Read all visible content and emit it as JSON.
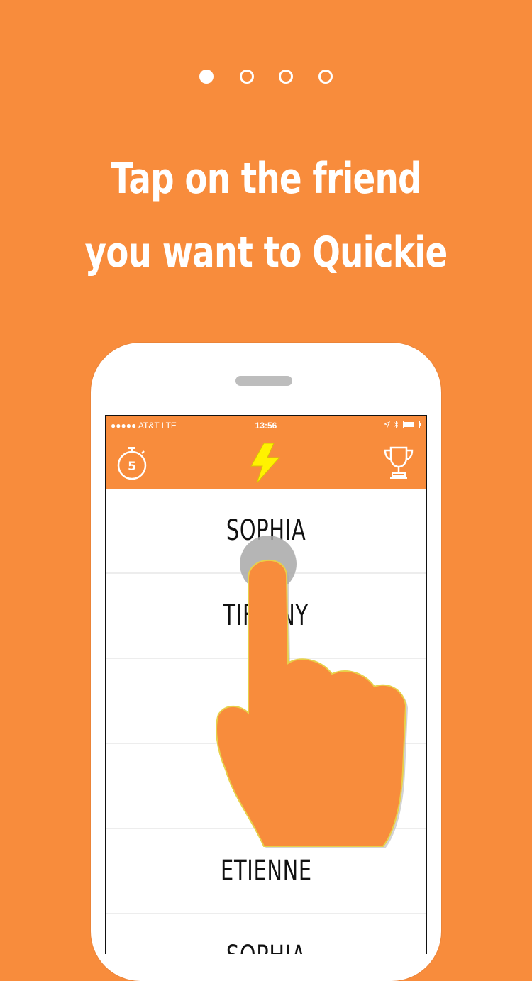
{
  "pager": {
    "count": 4,
    "active_index": 0
  },
  "headline": {
    "line1": "Tap on the friend",
    "line2": "you want to Quickie"
  },
  "status_bar": {
    "carrier": "●●●●● AT&T  LTE",
    "time": "13:56"
  },
  "nav": {
    "timer_value": "5",
    "icons": [
      "stopwatch-icon",
      "lightning-bolt-icon",
      "trophy-icon"
    ]
  },
  "friends": [
    "SOPHIA",
    "TIFFANY",
    "",
    "",
    "ETIENNE",
    "SOPHIA"
  ],
  "colors": {
    "brand_orange": "#F88C3C",
    "bolt_yellow": "#FFF200",
    "white": "#FFFFFF"
  }
}
